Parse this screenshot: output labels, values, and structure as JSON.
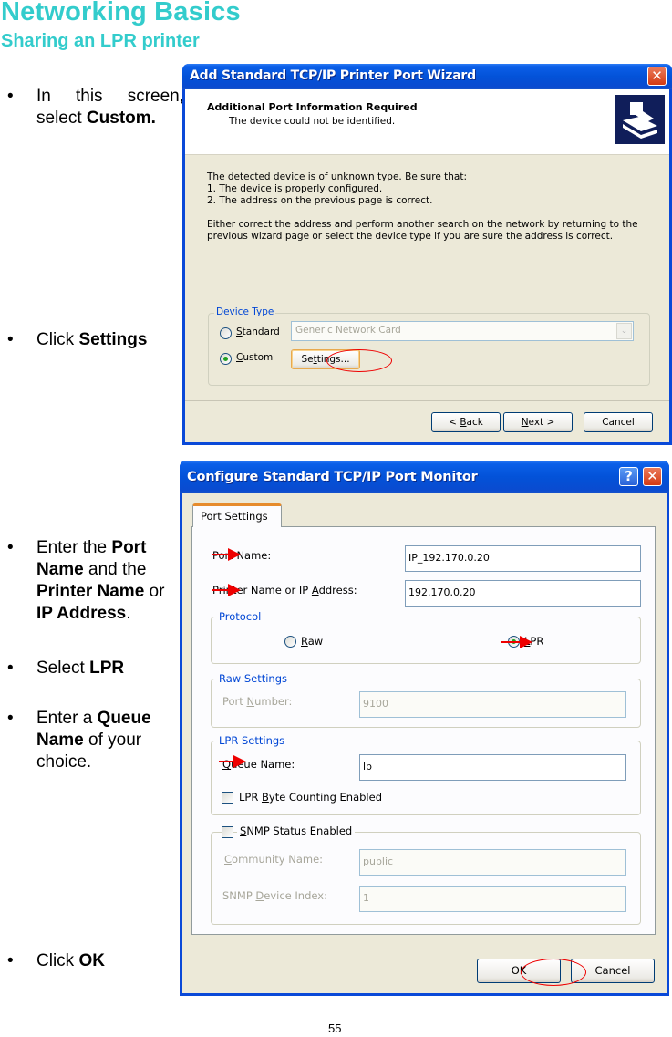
{
  "header": {
    "title": "Networking Basics",
    "subtitle": "Sharing an LPR printer"
  },
  "instructions": [
    {
      "parts": [
        {
          "t": "In this screen, select "
        },
        {
          "t": "Custom.",
          "b": true
        }
      ],
      "line1": [
        "In",
        "this",
        "screen,"
      ],
      "line2_plain": "select ",
      "line2_bold": "Custom."
    },
    {
      "plain": "Click ",
      "bold": "Settings"
    },
    {
      "lines": [
        [
          {
            "t": "Enter the "
          },
          {
            "t": "Port",
            "b": true
          }
        ],
        [
          {
            "t": "Name",
            "b": true
          },
          {
            "t": " and the"
          }
        ],
        [
          {
            "t": "Printer Name",
            "b": true
          },
          {
            "t": " or"
          }
        ],
        [
          {
            "t": "IP Address",
            "b": true
          },
          {
            "t": "."
          }
        ]
      ]
    },
    {
      "plain": "Select ",
      "bold": "LPR"
    },
    {
      "lines": [
        [
          {
            "t": "Enter a "
          },
          {
            "t": "Queue",
            "b": true
          }
        ],
        [
          {
            "t": "Name",
            "b": true
          },
          {
            "t": " of your"
          }
        ],
        [
          {
            "t": "choice."
          }
        ]
      ]
    },
    {
      "plain": "Click ",
      "bold": "OK"
    }
  ],
  "wizard": {
    "title": "Add Standard TCP/IP Printer Port Wizard",
    "close_glyph": "✕",
    "heading": "Additional Port Information Required",
    "subheading": "The device could not be identified.",
    "body_lines": [
      "The detected device is of unknown type.  Be sure that:",
      "1. The device is properly configured.",
      "2.  The address on the previous page is correct."
    ],
    "body_para": [
      "Either correct the address and perform another search on the network by returning to the",
      "previous wizard page or select the device type if you are sure the address is correct."
    ],
    "device_type_legend": "Device Type",
    "standard": {
      "label_u": "S",
      "label_rest": "tandard",
      "selected": false
    },
    "custom": {
      "label_u": "C",
      "label_rest": "ustom",
      "selected": true
    },
    "standard_dropdown_value": "Generic Network Card",
    "settings_button": {
      "pre": "Se",
      "u": "t",
      "post": "tings..."
    },
    "back_button": {
      "pre": "< ",
      "u": "B",
      "post": "ack"
    },
    "next_button": {
      "pre": "",
      "u": "N",
      "post": "ext >"
    },
    "cancel_button": "Cancel"
  },
  "monitor": {
    "title": "Configure Standard TCP/IP Port Monitor",
    "help_glyph": "?",
    "close_glyph": "✕",
    "tab": "Port Settings",
    "port_name_label": "Port Name:",
    "port_name_value": "IP_192.170.0.20",
    "printer_label": {
      "pre": "Printer Name or IP ",
      "u": "A",
      "post": "ddress:"
    },
    "printer_value": "192.170.0.20",
    "protocol_legend": "Protocol",
    "raw": {
      "u": "R",
      "rest": "aw",
      "selected": false
    },
    "lpr": {
      "u": "L",
      "rest": "PR",
      "selected": true
    },
    "raw_settings_legend": "Raw Settings",
    "port_number_label": {
      "pre": "Port ",
      "u": "N",
      "post": "umber:"
    },
    "port_number_value": "9100",
    "lpr_settings_legend": "LPR Settings",
    "queue_name_label": {
      "pre": "",
      "u": "Q",
      "post": "ueue Name:"
    },
    "queue_name_value": "lp",
    "byte_counting": {
      "pre": "LPR ",
      "u": "B",
      "post": "yte Counting Enabled",
      "checked": false
    },
    "snmp": {
      "pre": "",
      "u": "S",
      "post": "NMP Status Enabled",
      "checked": false
    },
    "community_label": {
      "pre": "",
      "u": "C",
      "post": "ommunity Name:"
    },
    "community_value": "public",
    "device_index_label": {
      "pre": "SNMP ",
      "u": "D",
      "post": "evice Index:"
    },
    "device_index_value": "1",
    "ok_button": "OK",
    "cancel_button": "Cancel"
  },
  "page_number": "55",
  "colors": {
    "heading": "#33cccc",
    "annotation": "#ee0000",
    "xp_title": "#0a49d8"
  }
}
